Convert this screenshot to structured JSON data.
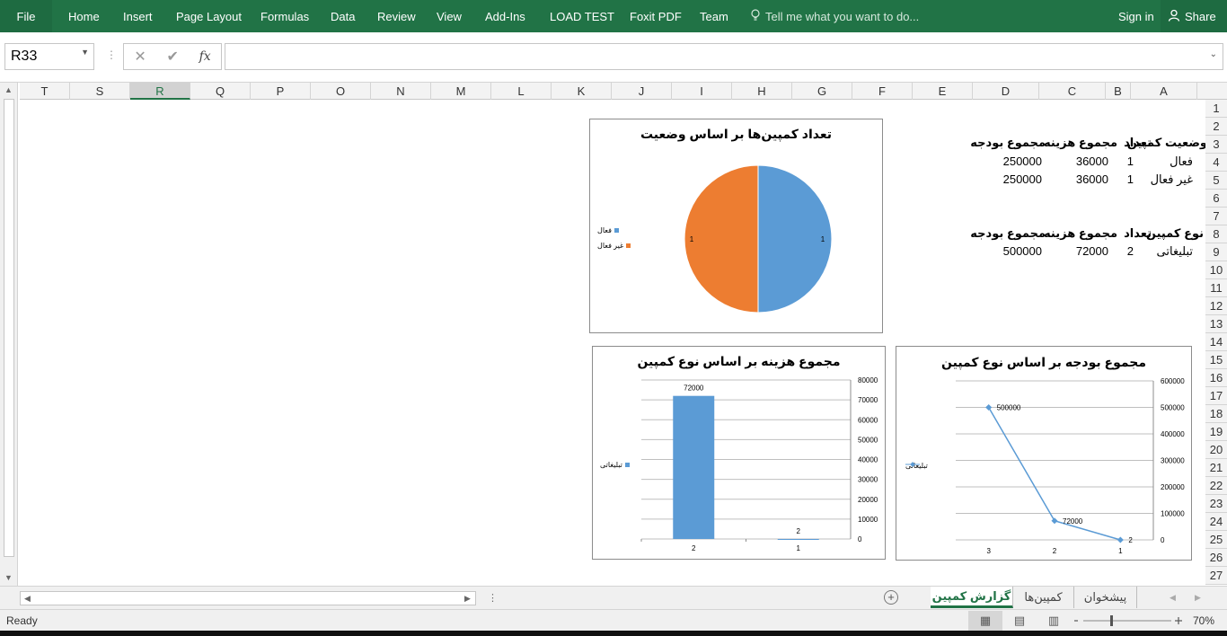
{
  "ribbon": {
    "file": "File",
    "tabs": [
      "Home",
      "Insert",
      "Page Layout",
      "Formulas",
      "Data",
      "Review",
      "View",
      "Add-Ins",
      "LOAD TEST",
      "Foxit PDF",
      "Team"
    ],
    "tell_me": "Tell me what you want to do...",
    "sign_in": "Sign in",
    "share": "Share"
  },
  "formula_bar": {
    "name_box": "R33",
    "fx": "fx",
    "formula": ""
  },
  "columns": [
    "T",
    "S",
    "R",
    "Q",
    "P",
    "O",
    "N",
    "M",
    "L",
    "K",
    "J",
    "I",
    "H",
    "G",
    "F",
    "E",
    "D",
    "C",
    "B",
    "A"
  ],
  "selected_column": "R",
  "rows": [
    "1",
    "2",
    "3",
    "4",
    "5",
    "6",
    "7",
    "8",
    "9",
    "10",
    "11",
    "12",
    "13",
    "14",
    "15",
    "16",
    "17",
    "18",
    "19",
    "20",
    "21",
    "22",
    "23",
    "24",
    "25",
    "26",
    "27"
  ],
  "tables": {
    "status": {
      "headers": [
        "وضعیت کمپین",
        "تعداد",
        "مجموع هزینه",
        "مجموع بودجه"
      ],
      "rows": [
        [
          "فعال",
          "1",
          "36000",
          "250000"
        ],
        [
          "غیر فعال",
          "1",
          "36000",
          "250000"
        ]
      ]
    },
    "type": {
      "headers": [
        "نوع کمپین",
        "تعداد",
        "مجموع هزینه",
        "مجموع بودجه"
      ],
      "rows": [
        [
          "تبلیغاتی",
          "2",
          "72000",
          "500000"
        ]
      ]
    }
  },
  "charts": {
    "pie": {
      "title": "تعداد کمپین‌ها بر اساس وضعیت",
      "legend": [
        "فعال",
        "غیر فعال"
      ],
      "labels": [
        "1",
        "1"
      ],
      "colors": [
        "#5b9bd5",
        "#ed7d31"
      ]
    },
    "bar": {
      "title": "مجموع هزینه بر اساس نوع کمپین",
      "legend": "تبلیغاتی",
      "color": "#5b9bd5",
      "yticks": [
        "80000",
        "70000",
        "60000",
        "50000",
        "40000",
        "30000",
        "20000",
        "10000",
        "0"
      ],
      "xticks": [
        "2",
        "1"
      ],
      "labels": [
        "72000",
        "2"
      ]
    },
    "line": {
      "title": "مجموع بودجه بر اساس نوع کمپین",
      "legend": "تبلیغاتی",
      "color": "#5b9bd5",
      "yticks": [
        "600000",
        "500000",
        "400000",
        "300000",
        "200000",
        "100000",
        "0"
      ],
      "xticks": [
        "3",
        "2",
        "1"
      ],
      "labels": [
        "500000",
        "72000",
        "2"
      ]
    }
  },
  "chart_data": [
    {
      "type": "pie",
      "title": "تعداد کمپین‌ها بر اساس وضعیت",
      "categories": [
        "فعال",
        "غیر فعال"
      ],
      "values": [
        1,
        1
      ],
      "legend": "left"
    },
    {
      "type": "bar",
      "title": "مجموع هزینه بر اساس نوع کمپین",
      "categories": [
        "2",
        "1"
      ],
      "series": [
        {
          "name": "تبلیغاتی",
          "values": [
            72000,
            2
          ]
        }
      ],
      "ylim": [
        0,
        80000
      ],
      "x_reversed": true,
      "y_axis_side": "right",
      "grid": true,
      "legend": "left"
    },
    {
      "type": "line",
      "title": "مجموع بودجه بر اساس نوع کمپین",
      "categories": [
        "3",
        "2",
        "1"
      ],
      "series": [
        {
          "name": "تبلیغاتی",
          "values": [
            500000,
            72000,
            2
          ]
        }
      ],
      "ylim": [
        0,
        600000
      ],
      "x_reversed": true,
      "y_axis_side": "right",
      "grid": true,
      "legend": "left"
    }
  ],
  "sheets": [
    "گزارش کمپین",
    "کمپین‌ها",
    "پیشخوان"
  ],
  "active_sheet": "گزارش کمپین",
  "status": {
    "ready": "Ready",
    "zoom": "70%"
  }
}
